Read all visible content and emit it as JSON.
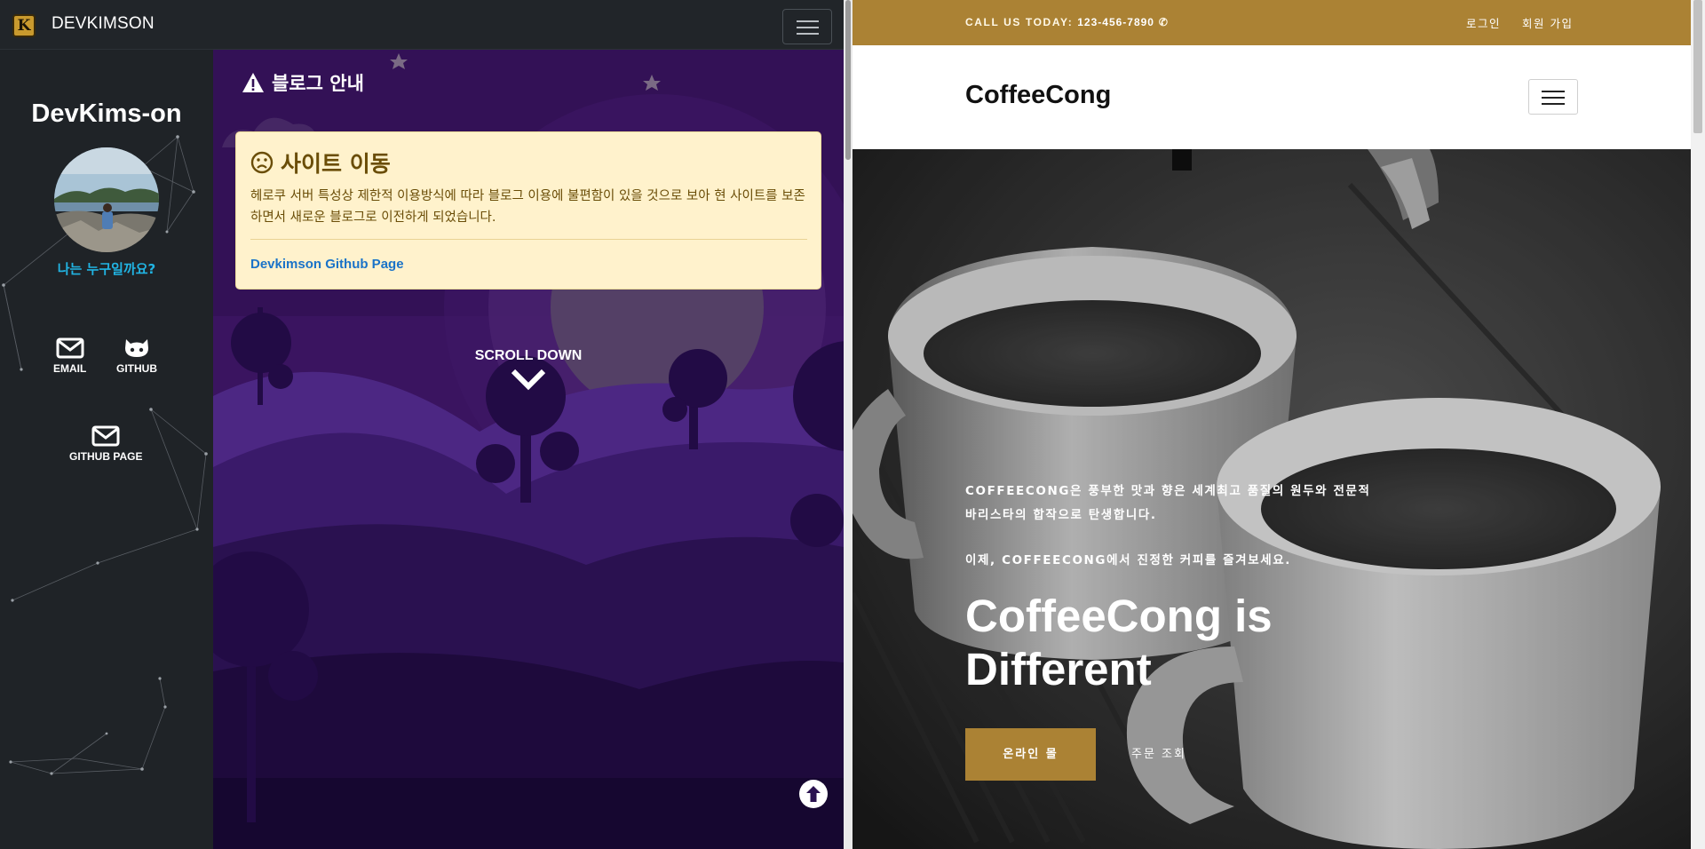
{
  "left_site": {
    "brand": {
      "logo_letter": "K",
      "name": "DEVKIMSON"
    },
    "sidebar": {
      "profile_name": "DevKims-on",
      "who_am_i": "나는 누구일까요?",
      "links": [
        {
          "label": "EMAIL",
          "icon": "envelope-icon"
        },
        {
          "label": "GITHUB",
          "icon": "github-icon"
        },
        {
          "label": "GITHUB PAGE",
          "icon": "envelope-icon"
        }
      ]
    },
    "main": {
      "notice_heading": "블로그 안내",
      "alert": {
        "title": "사이트 이동",
        "body": "헤로쿠 서버 특성상 제한적 이용방식에 따라 블로그 이용에 불편함이 있을 것으로 보아 현 사이트를 보존하면서 새로운 블로그로 이전하게 되었습니다.",
        "link": "Devkimson Github Page"
      },
      "scroll_down": "SCROLL DOWN"
    },
    "colors": {
      "alert_bg": "#fff2cc",
      "alert_text": "#6a4d07",
      "link": "#1a73c8",
      "accent_cyan": "#21b4e3",
      "scene_purple": "#3a1460"
    }
  },
  "right_site": {
    "topbar": {
      "call_label": "CALL US TODAY:",
      "phone": "123-456-7890",
      "login": "로그인",
      "signup": "회원 가입"
    },
    "logo": "CoffeeCong",
    "hero": {
      "description_line1": "COFFEECONG은 풍부한 맛과 향은 세계최고 품질의 원두와 전문적 바리스타의 합작으로 탄생합니다.",
      "description_line2": "이제, COFFEECONG에서 진정한 커피를 즐겨보세요.",
      "headline": "CoffeeCong is Different",
      "shop_button": "온라인 몰",
      "order_button": "주문 조회"
    },
    "colors": {
      "brand_gold": "#ab8234"
    }
  }
}
